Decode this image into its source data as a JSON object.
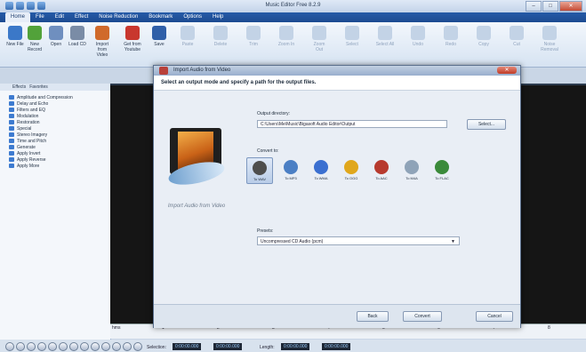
{
  "app": {
    "title": "Music Editor Free 8.2.9"
  },
  "ribbon_tabs": [
    "Home",
    "File",
    "Edit",
    "Effect",
    "Noise Reduction",
    "Bookmark",
    "Options",
    "Help"
  ],
  "ribbon_buttons": [
    {
      "label": "New File",
      "icon": "new-file-icon",
      "color": "#3b78c8"
    },
    {
      "label": "New Record",
      "icon": "record-icon",
      "color": "#52a23a"
    },
    {
      "label": "Open",
      "icon": "open-folder-icon",
      "color": "#6f8fbf"
    },
    {
      "label": "Load CD",
      "icon": "cd-icon",
      "color": "#7a8ca6"
    },
    {
      "label": "Import from Video",
      "icon": "import-video-icon",
      "color": "#d06a2b"
    },
    {
      "label": "Get from Youtube",
      "icon": "youtube-icon",
      "color": "#c8372e"
    },
    {
      "label": "Save",
      "icon": "save-icon",
      "color": "#2f5fa8"
    }
  ],
  "ribbon_disabled": [
    "Paste",
    "Delete",
    "Trim",
    "Zoom In",
    "Zoom Out",
    "Select",
    "Select All",
    "Undo",
    "Redo",
    "Copy",
    "Cut",
    "Noise Removal"
  ],
  "left_panel": {
    "tabs": [
      "Effects",
      "Favorites"
    ],
    "effects": [
      "Amplitude and Compression",
      "Delay and Echo",
      "Filters and EQ",
      "Modulation",
      "Restoration",
      "Special",
      "Stereo Imagery",
      "Time and Pitch",
      "Generate",
      "Apply Invert",
      "Apply Reverse",
      "Apply More"
    ]
  },
  "timeline": {
    "ticks": [
      "hms",
      "1",
      "2",
      "3",
      "4",
      "5",
      "6",
      "7",
      "8"
    ]
  },
  "bottom": {
    "selection_label": "Selection:",
    "selection_start": "0:00:00.000",
    "selection_end": "0:00:00.000",
    "length_label": "Length:",
    "length_start": "0:00:00.000",
    "length_end": "0:00:00.000"
  },
  "dialog": {
    "title": "Import Audio from Video",
    "header": "Select an output mode and specify a path for the output files.",
    "side_caption": "Import Audio from Video",
    "output_dir_label": "Output directory:",
    "output_dir_value": "C:\\Users\\Me\\Music\\Bigasoft Audio Editor\\Output",
    "select_button": "Select...",
    "convert_to_label": "Convert to:",
    "formats": [
      {
        "label": "To WAV",
        "icon": "wav-icon",
        "color": "#4d4d4d",
        "selected": true
      },
      {
        "label": "To MP3",
        "icon": "mp3-icon",
        "color": "#4b7fc4",
        "selected": false
      },
      {
        "label": "To WMA",
        "icon": "wma-icon",
        "color": "#3a6fd0",
        "selected": false
      },
      {
        "label": "To OGG",
        "icon": "ogg-icon",
        "color": "#e0a71c",
        "selected": false
      },
      {
        "label": "To AAC",
        "icon": "aac-icon",
        "color": "#b73a2e",
        "selected": false
      },
      {
        "label": "To M4A",
        "icon": "m4a-icon",
        "color": "#8fa3b8",
        "selected": false
      },
      {
        "label": "To FLAC",
        "icon": "flac-icon",
        "color": "#3a8a3a",
        "selected": false
      }
    ],
    "presets_label": "Presets:",
    "preset_value": "Uncompressed CD Audio (pcm)",
    "buttons": {
      "back": "Back",
      "convert": "Convert",
      "cancel": "Cancel"
    }
  }
}
